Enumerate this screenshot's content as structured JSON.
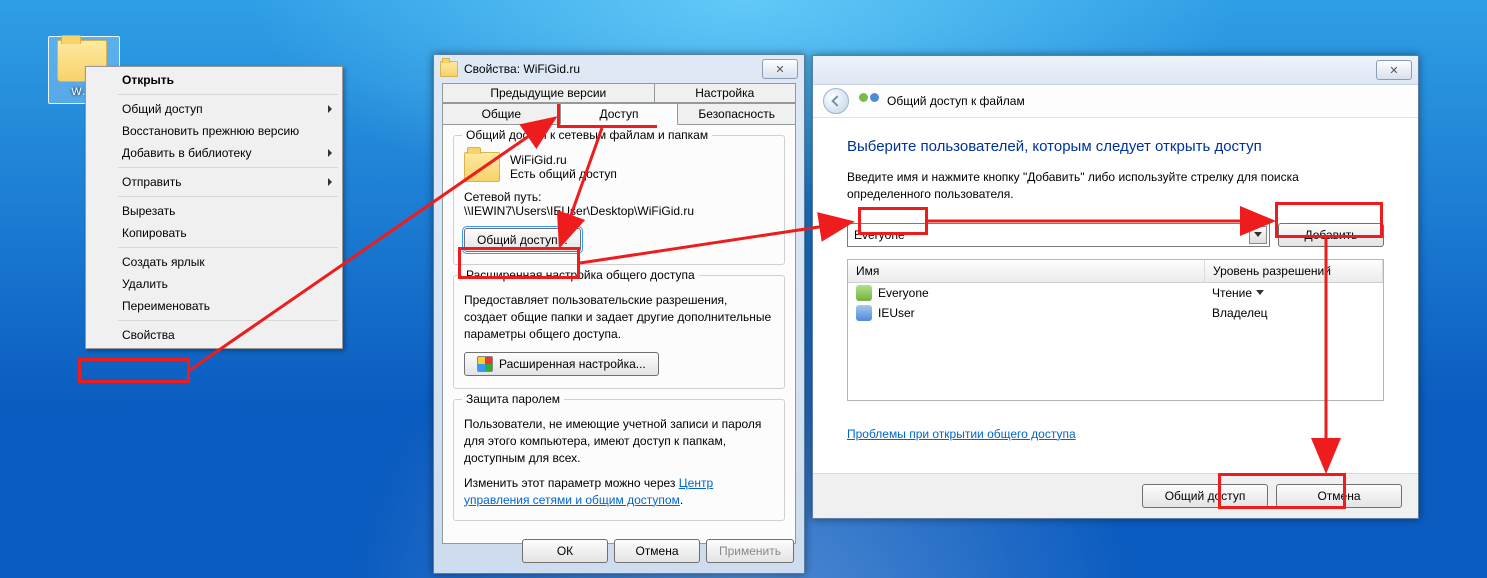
{
  "desktop": {
    "folder_label": "W…"
  },
  "context_menu": {
    "items": [
      {
        "label": "Открыть",
        "bold": true
      },
      {
        "sep": true
      },
      {
        "label": "Общий доступ",
        "sub": true
      },
      {
        "label": "Восстановить прежнюю версию"
      },
      {
        "label": "Добавить в библиотеку",
        "sub": true
      },
      {
        "sep": true
      },
      {
        "label": "Отправить",
        "sub": true
      },
      {
        "sep": true
      },
      {
        "label": "Вырезать"
      },
      {
        "label": "Копировать"
      },
      {
        "sep": true
      },
      {
        "label": "Создать ярлык"
      },
      {
        "label": "Удалить"
      },
      {
        "label": "Переименовать"
      },
      {
        "sep": true
      },
      {
        "label": "Свойства"
      }
    ]
  },
  "props": {
    "title": "Свойства: WiFiGid.ru",
    "tabs_top": [
      "Предыдущие версии",
      "Настройка"
    ],
    "tabs_bot": [
      "Общие",
      "Доступ",
      "Безопасность"
    ],
    "g1_legend": "Общий доступ к сетевым файлам и папкам",
    "share_name": "WiFiGid.ru",
    "share_state": "Есть общий доступ",
    "netpath_label": "Сетевой путь:",
    "netpath": "\\\\IEWIN7\\Users\\IEUser\\Desktop\\WiFiGid.ru",
    "btn_share": "Общий доступ...",
    "g2_legend": "Расширенная настройка общего доступа",
    "g2_desc": "Предоставляет пользовательские разрешения, создает общие папки и задает другие дополнительные параметры общего доступа.",
    "btn_adv": "Расширенная настройка...",
    "g3_legend": "Защита паролем",
    "g3_desc1": "Пользователи, не имеющие учетной записи и пароля для этого компьютера, имеют доступ к папкам, доступным для всех.",
    "g3_desc2_pre": "Изменить этот параметр можно через ",
    "g3_link": "Центр управления сетями и общим доступом",
    "ok": "ОК",
    "cancel": "Отмена",
    "apply": "Применить"
  },
  "share": {
    "stripe_title": "Общий доступ к файлам",
    "heading": "Выберите пользователей, которым следует открыть доступ",
    "instr": "Введите имя и нажмите кнопку \"Добавить\" либо используйте стрелку для поиска определенного пользователя.",
    "combo_value": "Everyone",
    "btn_add": "Добавить",
    "col_name": "Имя",
    "col_perm": "Уровень разрешений",
    "rows": [
      {
        "icon": "grp",
        "name": "Everyone",
        "perm": "Чтение",
        "dd": true
      },
      {
        "icon": "usr",
        "name": "IEUser",
        "perm": "Владелец",
        "dd": false
      }
    ],
    "help_link": "Проблемы при открытии общего доступа",
    "btn_share": "Общий доступ",
    "btn_cancel": "Отмена"
  }
}
